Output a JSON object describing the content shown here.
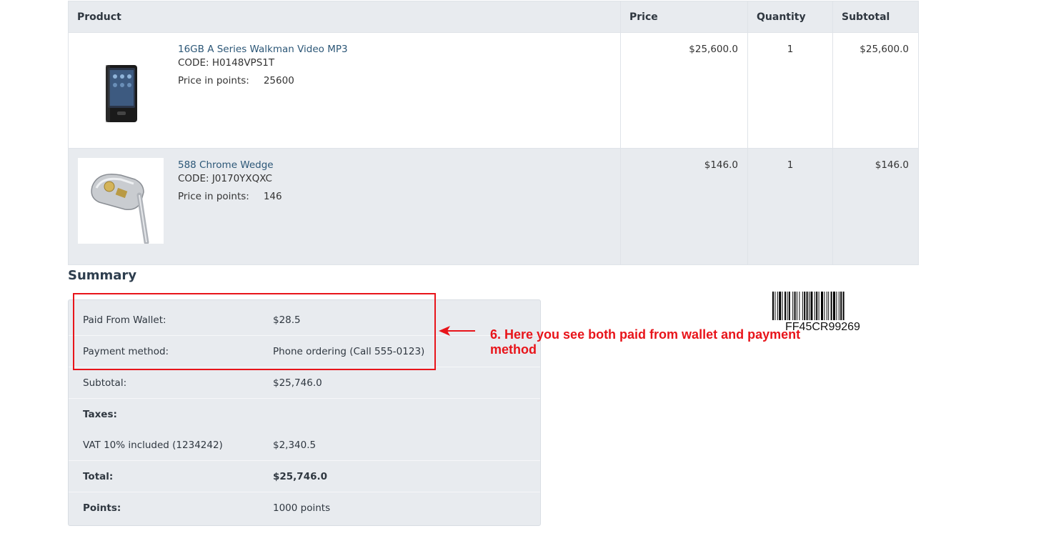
{
  "table": {
    "headers": {
      "product": "Product",
      "price": "Price",
      "quantity": "Quantity",
      "subtotal": "Subtotal"
    },
    "rows": [
      {
        "name": "16GB A Series Walkman Video MP3",
        "code": "CODE: H0148VPS1T",
        "points_label": "Price in points:",
        "points": "25600",
        "price": "$25,600.0",
        "quantity": "1",
        "subtotal": "$25,600.0",
        "image_icon": "mp3-player-image"
      },
      {
        "name": "588 Chrome Wedge",
        "code": "CODE: J0170YXQXC",
        "points_label": "Price in points:",
        "points": "146",
        "price": "$146.0",
        "quantity": "1",
        "subtotal": "$146.0",
        "image_icon": "golf-wedge-image"
      }
    ]
  },
  "summary": {
    "title": "Summary",
    "rows": [
      {
        "label": "Paid From Wallet:",
        "value": "$28.5"
      },
      {
        "label": "Payment method:",
        "value": "Phone ordering (Call 555-0123)"
      },
      {
        "label": "Subtotal:",
        "value": "$25,746.0"
      },
      {
        "label": "Taxes:",
        "value": ""
      },
      {
        "label": "VAT 10% included (1234242)",
        "value": "$2,340.5"
      },
      {
        "label": "Total:",
        "value": "$25,746.0"
      },
      {
        "label": "Points:",
        "value": "1000 points"
      }
    ]
  },
  "annotation": {
    "text": "6. Here you see both paid from wallet and payment method",
    "color": "#e8141a"
  },
  "barcode": {
    "code": "FF45CR99269"
  },
  "colors": {
    "link": "#2c5777",
    "header_bg": "#e8ebef",
    "highlight": "#e8141a"
  }
}
